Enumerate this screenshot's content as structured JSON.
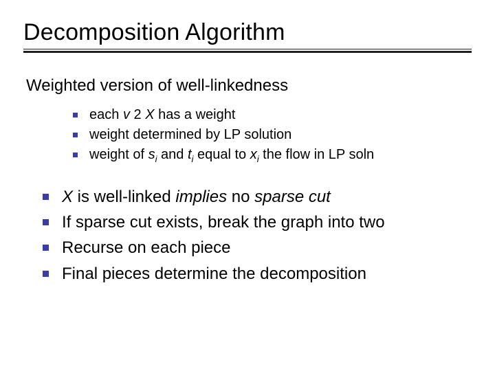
{
  "title": "Decomposition Algorithm",
  "subtitle": "Weighted version of well-linkedness",
  "inner_bullets": [
    {
      "pre": "each ",
      "it1": "v ",
      "mid1": "2 ",
      "it2": "X",
      "mid2": " has a weight",
      "sub1": "",
      "it3": "",
      "mid3": "",
      "sub2": "",
      "it4": "",
      "tail": ""
    },
    {
      "pre": "weight determined by LP solution",
      "it1": "",
      "mid1": "",
      "it2": "",
      "mid2": "",
      "sub1": "",
      "it3": "",
      "mid3": "",
      "sub2": "",
      "it4": "",
      "tail": ""
    },
    {
      "pre": "weight of ",
      "it1": "s",
      "sub1": "i",
      "mid1": " and ",
      "it2": "t",
      "sub2": "i",
      "mid2": " equal to ",
      "it3": "x",
      "sub3": "i",
      "mid3": " the flow in LP soln",
      "it4": "",
      "tail": ""
    }
  ],
  "outer_bullets": [
    {
      "pre": "",
      "it1": "X",
      "mid1": " is well-linked ",
      "it2": "implies",
      "mid2": " no ",
      "it3": "sparse cut",
      "tail": ""
    },
    {
      "pre": "If sparse cut exists, break the graph into two",
      "it1": "",
      "mid1": "",
      "it2": "",
      "mid2": "",
      "it3": "",
      "tail": ""
    },
    {
      "pre": "Recurse on each piece",
      "it1": "",
      "mid1": "",
      "it2": "",
      "mid2": "",
      "it3": "",
      "tail": ""
    },
    {
      "pre": "Final pieces determine the decomposition",
      "it1": "",
      "mid1": "",
      "it2": "",
      "mid2": "",
      "it3": "",
      "tail": ""
    }
  ]
}
